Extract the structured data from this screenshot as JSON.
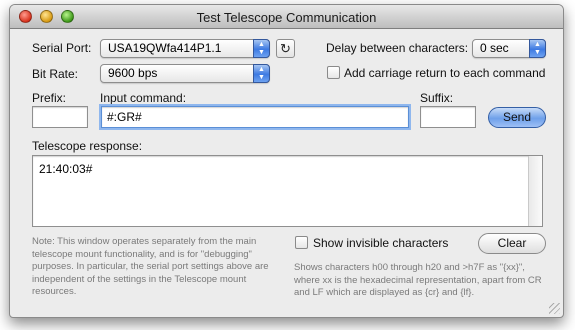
{
  "window": {
    "title": "Test Telescope Communication"
  },
  "serial_port": {
    "label": "Serial Port:",
    "value": "USA19QWfa414P1.1",
    "refresh_icon": "refresh-icon"
  },
  "delay": {
    "label": "Delay between characters:",
    "value": "0 sec"
  },
  "bit_rate": {
    "label": "Bit Rate:",
    "value": "9600 bps"
  },
  "carriage_return": {
    "label": "Add carriage return to each command",
    "checked": false
  },
  "prefix": {
    "label": "Prefix:",
    "value": ""
  },
  "input_command": {
    "label": "Input command:",
    "value": "#:GR#"
  },
  "suffix": {
    "label": "Suffix:",
    "value": ""
  },
  "send_button": {
    "label": "Send"
  },
  "response": {
    "label": "Telescope response:",
    "value": "21:40:03#"
  },
  "note": "Note: This window operates separately from the main telescope mount functionality, and is for \"debugging\" purposes. In particular, the serial port settings above are independent of the settings in the Telescope mount resources.",
  "show_invisible": {
    "label": "Show invisible characters",
    "checked": false
  },
  "clear_button": {
    "label": "Clear"
  },
  "invisible_help": "Shows characters h00 through h20 and >h7F as \"{xx}\", where xx is the hexadecimal representation, apart from CR and LF which are displayed as {cr} and {lf}."
}
